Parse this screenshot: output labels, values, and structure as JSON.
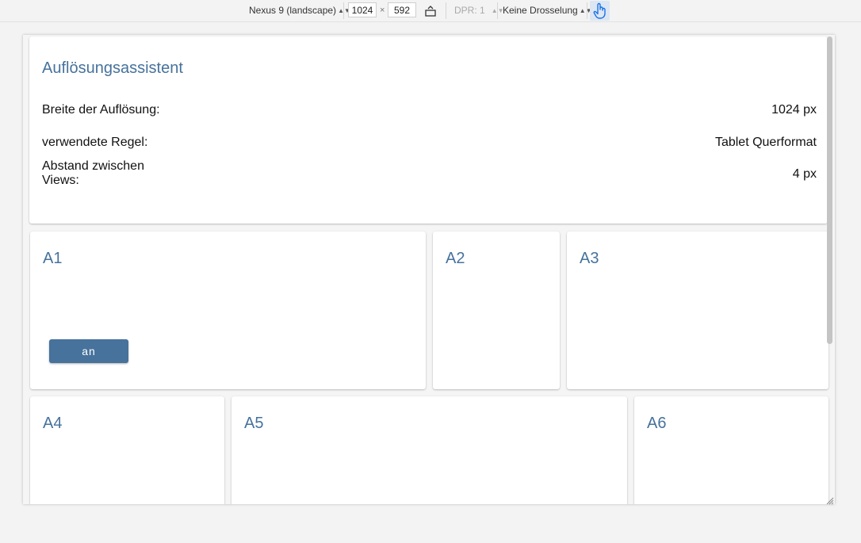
{
  "devtools": {
    "device": "Nexus 9 (landscape)",
    "width_value": "1024",
    "times": "×",
    "height_value": "592",
    "dpr": "DPR: 1",
    "throttling": "Keine Drosselung"
  },
  "assistant": {
    "title": "Auflösungsassistent",
    "rows": [
      {
        "label": "Breite der Auflösung:",
        "value": "1024 px"
      },
      {
        "label": "verwendete Regel:",
        "value": "Tablet Querformat"
      },
      {
        "label": "Abstand zwischen Views:",
        "value": "4 px"
      }
    ]
  },
  "panels": {
    "a1": {
      "title": "A1",
      "button_label": "an"
    },
    "a2": {
      "title": "A2"
    },
    "a3": {
      "title": "A3"
    },
    "a4": {
      "title": "A4"
    },
    "a5": {
      "title": "A5"
    },
    "a6": {
      "title": "A6"
    }
  },
  "colors": {
    "accent": "#46729c",
    "card_bg": "#ffffff",
    "page_bg": "#f3f3f3"
  }
}
